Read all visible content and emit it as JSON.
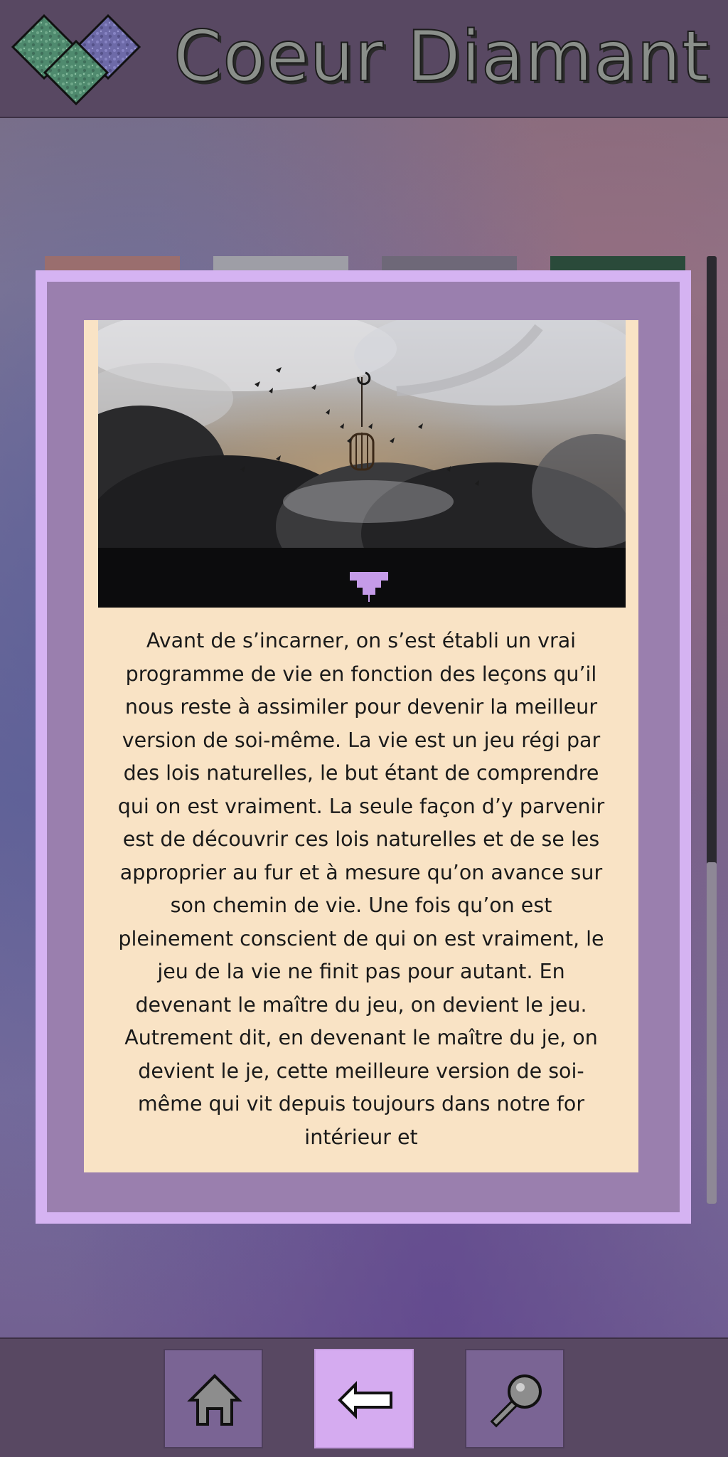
{
  "header": {
    "title": "Coeur Diamant"
  },
  "colors": {
    "header_bg": "#584862",
    "dialog_border": "#d5b3f2",
    "dialog_frame": "#9a7fae",
    "panel_bg": "#f9e3c5",
    "nav_active": "#d5abf0",
    "nav_inactive": "#7a6494"
  },
  "content": {
    "paragraph": "Avant de s’incarner, on s’est établi un vrai programme de vie en fonction des leçons qu’il nous reste à assimiler pour devenir la meilleur version de soi-même. La vie est un jeu régi par des lois naturelles, le but étant de comprendre qui on est vraiment. La seule façon d’y parvenir est de découvrir ces lois naturelles et de se les approprier au fur et à mesure qu’on avance sur son chemin de vie. Une fois qu’on est pleinement conscient de qui on est vraiment, le jeu de la vie ne finit pas pour autant. En devenant le maître du jeu, on devient le jeu. Autrement dit, en devenant le maître du je, on devient le je, cette meilleure version de soi-même qui vit depuis toujours dans notre for intérieur et"
  },
  "scroll": {
    "position_fraction": 0.64
  },
  "icons": {
    "logo": "diamond-heart-logo-icon",
    "expand": "triangle-down-icon",
    "home": "home-icon",
    "back": "arrow-left-icon",
    "search": "magnifier-icon"
  },
  "nav": {
    "active_index": 1
  }
}
